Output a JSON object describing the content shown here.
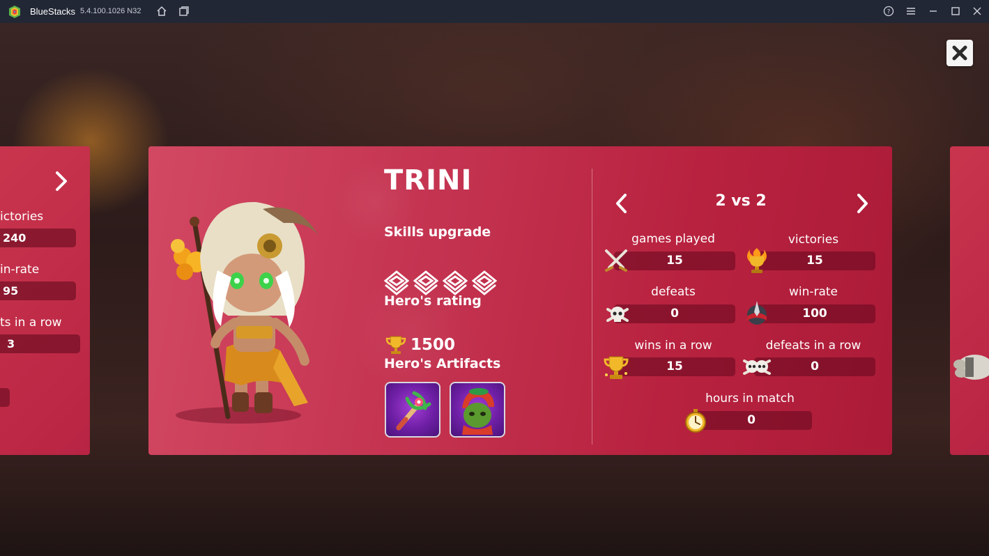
{
  "titlebar": {
    "app_name": "BlueStacks",
    "version": "5.4.100.1026  N32",
    "icons": [
      "home-icon",
      "multi-instance-icon",
      "help-icon",
      "menu-icon",
      "minimize-icon",
      "maximize-icon",
      "close-icon"
    ]
  },
  "left_card": {
    "labels": [
      "ictories",
      "in-rate",
      "ts in a row"
    ],
    "values": [
      "240",
      "95",
      "3"
    ]
  },
  "hero": {
    "name": "TRINI",
    "skills_label": "Skills upgrade",
    "skills_count": 4,
    "rating_label": "Hero's rating",
    "rating_value": "1500",
    "artifacts_label": "Hero's Artifacts",
    "artifacts": [
      "staff-artifact-icon",
      "goblin-hood-artifact-icon"
    ]
  },
  "stats": {
    "mode": "2 vs 2",
    "games_played": {
      "label": "games played",
      "value": "15"
    },
    "victories": {
      "label": "victories",
      "value": "15"
    },
    "defeats": {
      "label": "defeats",
      "value": "0"
    },
    "win_rate": {
      "label": "win-rate",
      "value": "100"
    },
    "wins_in_a_row": {
      "label": "wins in a row",
      "value": "15"
    },
    "defeats_in_a_row": {
      "label": "defeats in a row",
      "value": "0"
    },
    "hours_in_match": {
      "label": "hours in match",
      "value": "0"
    }
  },
  "pager": {
    "count": 6,
    "active_index": 2
  },
  "colors": {
    "card": "#c53552",
    "titlebar": "#222735",
    "stat_bar": "#64081e"
  }
}
